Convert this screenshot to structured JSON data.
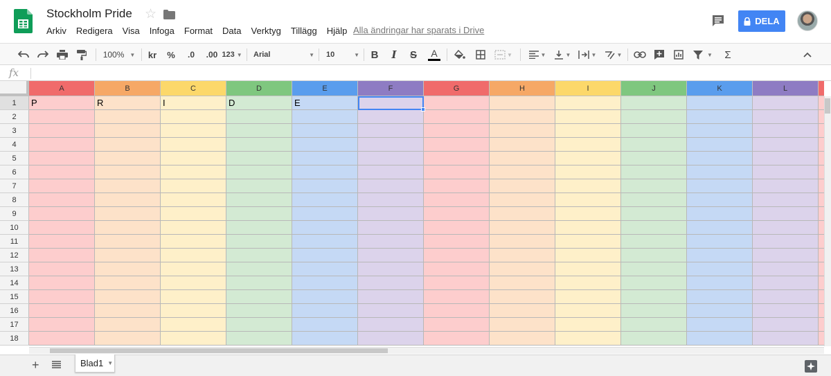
{
  "app": {
    "title": "Stockholm Pride",
    "menu": [
      "Arkiv",
      "Redigera",
      "Visa",
      "Infoga",
      "Format",
      "Data",
      "Verktyg",
      "Tillägg",
      "Hjälp"
    ],
    "saved_status": "Alla ändringar har sparats i Drive",
    "share_label": "DELA",
    "icons": {
      "logo": "sheets-logo-icon",
      "star": "star-icon",
      "folder": "folder-icon",
      "comments": "comments-icon",
      "lock": "lock-icon",
      "avatar": "user-avatar"
    }
  },
  "toolbar": {
    "zoom": "100%",
    "currency": "kr",
    "percent": "%",
    "decrease_decimals": ".0",
    "increase_decimals": ".00",
    "more_formats": "123",
    "font": "Arial",
    "font_size": "10",
    "bold": "B",
    "italic": "I",
    "strikethrough": "S",
    "text_color": "A",
    "sigma": "Σ"
  },
  "formula_bar": {
    "label": "fx",
    "value": ""
  },
  "grid": {
    "columns": [
      "A",
      "B",
      "C",
      "D",
      "E",
      "F",
      "G",
      "H",
      "I",
      "J",
      "K",
      "L"
    ],
    "rows": [
      "1",
      "2",
      "3",
      "4",
      "5",
      "6",
      "7",
      "8",
      "9",
      "10",
      "11",
      "12",
      "13",
      "14",
      "15",
      "16",
      "17",
      "18"
    ],
    "header_colors": [
      "#f06b6b",
      "#f6a866",
      "#fcd86a",
      "#7fc77f",
      "#5a9ded",
      "#8e7cc3",
      "#f06b6b",
      "#f6a866",
      "#fcd86a",
      "#7fc77f",
      "#5a9ded",
      "#8e7cc3"
    ],
    "cell_colors": [
      "#fdcdcd",
      "#fde2c9",
      "#fef0c9",
      "#d3ead3",
      "#c5d9f5",
      "#dcd3eb",
      "#fdcdcd",
      "#fde2c9",
      "#fef0c9",
      "#d3ead3",
      "#c5d9f5",
      "#dcd3eb"
    ],
    "row1_values": [
      "P",
      "R",
      "I",
      "D",
      "E",
      "",
      "",
      "",
      "",
      "",
      "",
      ""
    ],
    "active_cell": "F1"
  },
  "sheets": {
    "tabs": [
      "Blad1"
    ],
    "add_label": "+"
  }
}
